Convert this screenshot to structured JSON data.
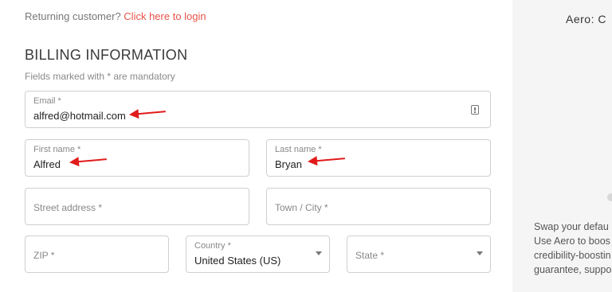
{
  "returning": {
    "text": "Returning customer?",
    "link": "Click here to login"
  },
  "billing": {
    "title": "BILLING INFORMATION",
    "mandatory_note": "Fields marked with * are mandatory"
  },
  "fields": {
    "email": {
      "label": "Email *",
      "value": "alfred@hotmail.com"
    },
    "first_name": {
      "label": "First name *",
      "value": "Alfred"
    },
    "last_name": {
      "label": "Last name *",
      "value": "Bryan"
    },
    "street": {
      "placeholder": "Street address *"
    },
    "town": {
      "placeholder": "Town / City *"
    },
    "zip": {
      "placeholder": "ZIP *"
    },
    "country": {
      "label": "Country *",
      "value": "United States (US)"
    },
    "state": {
      "placeholder": "State *"
    }
  },
  "sidebar": {
    "product_title": "Aero: C",
    "description": [
      "Swap your defau",
      "Use Aero to boos",
      "credibility-boostin",
      "guarantee, suppo"
    ]
  },
  "colors": {
    "link": "#e8534a",
    "annotation_arrow": "#e11b1b",
    "sidebar_bg": "#f5f5f5"
  },
  "icons": {
    "email_autofill": "contact-card-icon",
    "select_caret": "caret-down-icon"
  }
}
